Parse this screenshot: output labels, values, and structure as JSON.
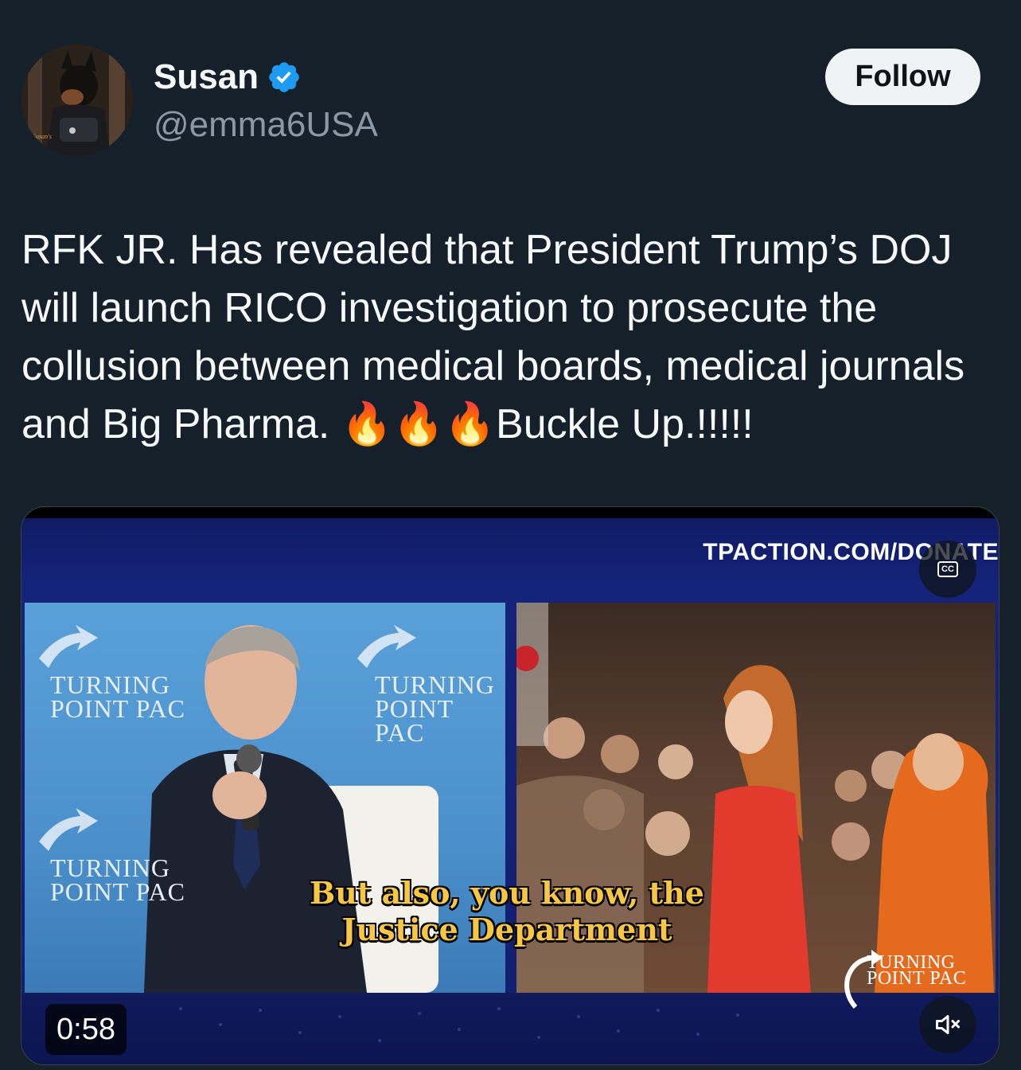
{
  "author": {
    "name": "Susan",
    "handle": "@emma6USA",
    "verified": true
  },
  "follow_button": {
    "label": "Follow"
  },
  "tweet": {
    "text": "RFK JR. Has revealed that President Trump’s DOJ will launch RICO investigation to prosecute the collusion between medical boards, medical journals and Big Pharma. 🔥🔥🔥Buckle Up.!!!!!"
  },
  "video": {
    "overlay_url": "TPACTION.COM/DONATE",
    "brand_line1": "TURNING",
    "brand_line2": "POINT PAC",
    "caption": "But also, you know, the\nJustice Department",
    "duration": "0:58",
    "cc_label": "CC",
    "muted": true
  },
  "colors": {
    "background": "#15202b",
    "verified_badge": "#1d9bf0",
    "handle": "#8b98a5",
    "follow_bg": "#eff3f4",
    "caption": "#f7c743"
  },
  "icons": {
    "verified": "verified-badge-icon",
    "cc": "closed-captions-icon",
    "mute": "speaker-muted-icon"
  }
}
